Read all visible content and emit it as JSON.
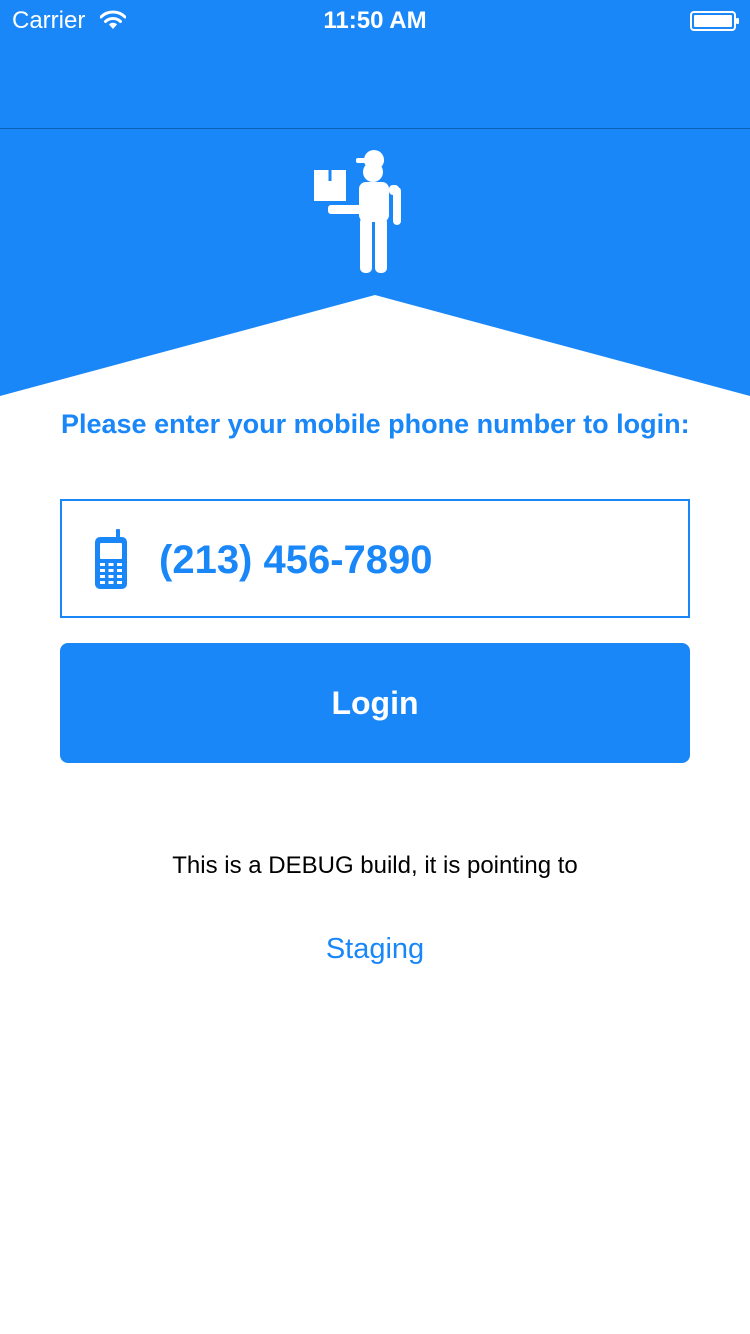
{
  "status_bar": {
    "carrier": "Carrier",
    "time": "11:50 AM",
    "wifi_icon": "wifi-icon",
    "battery_icon": "battery-icon"
  },
  "hero": {
    "icon": "delivery-man-icon"
  },
  "login": {
    "prompt": "Please enter your mobile phone number to login:",
    "phone_icon": "mobile-phone-icon",
    "phone_value": "(213) 456-7890",
    "button_label": "Login"
  },
  "footer": {
    "debug_note": "This is a DEBUG build, it is pointing to",
    "environment": "Staging"
  },
  "colors": {
    "accent": "#1a87f9",
    "background": "#ffffff",
    "text": "#000000"
  }
}
